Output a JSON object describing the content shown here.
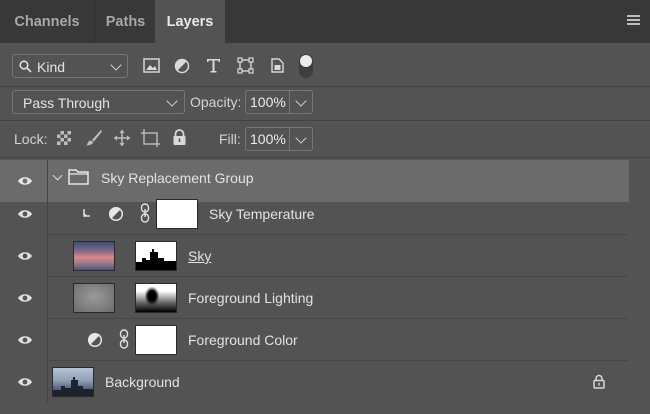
{
  "tabs": [
    {
      "label": "Channels"
    },
    {
      "label": "Paths"
    },
    {
      "label": "Layers"
    }
  ],
  "filter": {
    "label": "Kind",
    "icons": [
      "image-filter-icon",
      "adjustment-filter-icon",
      "type-filter-icon",
      "shape-filter-icon",
      "smart-object-filter-icon",
      "filter-toggle-icon"
    ]
  },
  "blend": {
    "mode": "Pass Through",
    "opacity_label": "Opacity:",
    "opacity_value": "100%"
  },
  "lock": {
    "label": "Lock:",
    "icons": [
      "lock-transparent-pixels-icon",
      "lock-image-pixels-icon",
      "lock-position-icon",
      "lock-artboard-icon",
      "lock-all-icon"
    ],
    "fill_label": "Fill:",
    "fill_value": "100%"
  },
  "layers": [
    {
      "name": "Sky Replacement Group",
      "type": "group",
      "expanded": true,
      "visible": true
    },
    {
      "name": "Sky Temperature",
      "type": "adjustment",
      "clipped": true,
      "visible": true
    },
    {
      "name": "Sky",
      "type": "image-with-mask",
      "visible": true
    },
    {
      "name": "Foreground Lighting",
      "type": "image-with-mask",
      "visible": true
    },
    {
      "name": "Foreground Color",
      "type": "adjustment",
      "visible": true
    },
    {
      "name": "Background",
      "type": "background",
      "locked": true,
      "visible": true
    }
  ],
  "colors": {
    "panel": "#535353",
    "tabbar": "#383838",
    "group_row": "#6b6b6b"
  }
}
